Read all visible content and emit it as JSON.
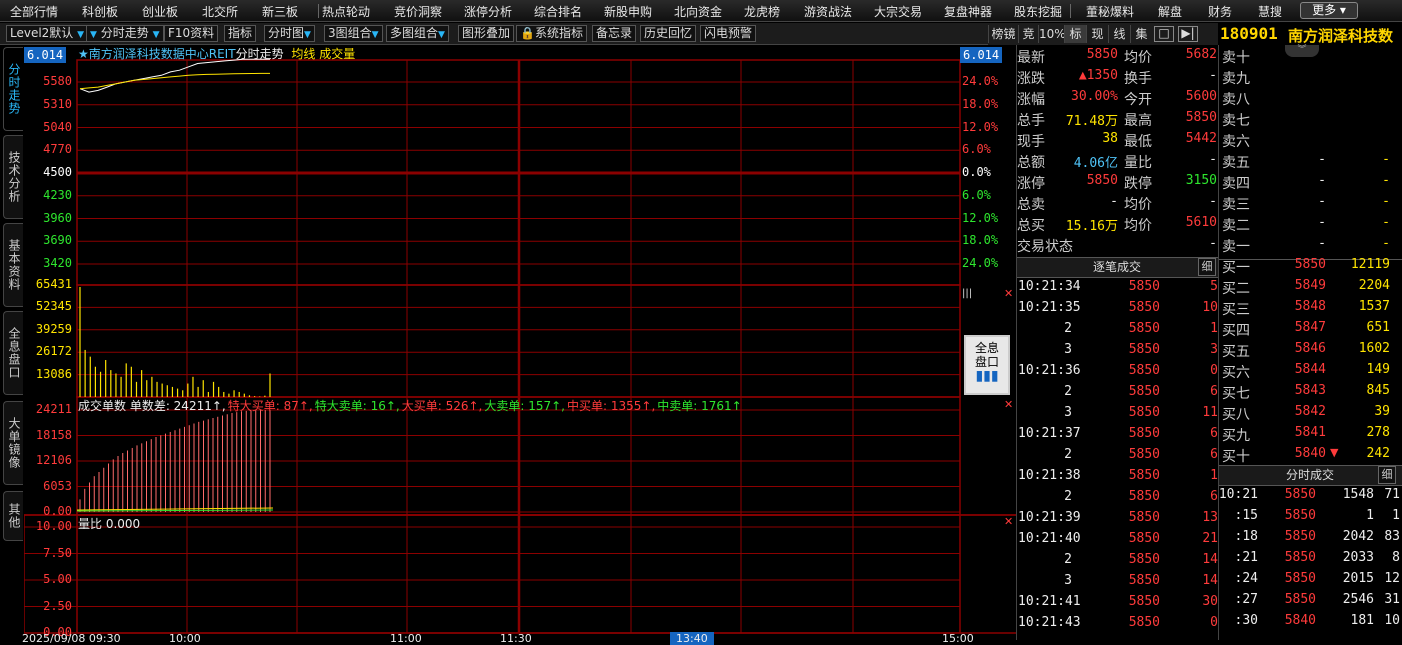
{
  "top_menu": [
    "全部行情",
    "科创板",
    "创业板",
    "北交所",
    "新三板",
    "热点轮动",
    "竞价洞察",
    "涨停分析",
    "综合排名",
    "新股申购",
    "北向资金",
    "龙虎榜",
    "游资战法",
    "大宗交易",
    "复盘神器",
    "股东挖掘",
    "董秘爆料",
    "解盘",
    "财务",
    "慧搜"
  ],
  "more_label": "更多",
  "toolbar": {
    "level2": "Level2默认",
    "timeshare": "分时走势",
    "f10": "F10资料",
    "indicator": "指标",
    "timechart": "分时图",
    "combo3": "3图组合",
    "combo_multi": "多图组合",
    "overlay": "图形叠加",
    "sys_indicator": "系统指标",
    "memo": "备忘录",
    "history": "历史回忆",
    "flash": "闪电预警"
  },
  "right_toolbar": [
    "榜镜",
    "竞",
    "10%",
    "标",
    "现",
    "线",
    "集"
  ],
  "security": {
    "code": "180901",
    "name": "南方润泽科技数"
  },
  "side_tabs": [
    "分时走势",
    "技术分析",
    "基本资料",
    "全息盘口",
    "大单镜像",
    "其他"
  ],
  "chart_header": {
    "badge": "6.014",
    "title": "★南方润泽科技数据中心REIT",
    "mode": "分时走势",
    "avg_label": "均线",
    "vol_label": "成交量"
  },
  "price_axis": {
    "left": [
      "5580",
      "5310",
      "5040",
      "4770",
      "4500",
      "4230",
      "3960",
      "3690",
      "3420"
    ],
    "right": [
      "24.0%",
      "18.0%",
      "12.0%",
      "6.0%",
      "0.0%",
      "6.0%",
      "12.0%",
      "18.0%",
      "24.0%"
    ]
  },
  "volume_axis": [
    "65431",
    "52345",
    "39259",
    "26172",
    "13086"
  ],
  "order_panel": {
    "header": "成交单数 单数差: 24211↑,",
    "items": [
      {
        "label": "特大买单: 87↑,",
        "color": "#ff3b3b"
      },
      {
        "label": "特大卖单: 16↑,",
        "color": "#2ee62e"
      },
      {
        "label": "大买单: 526↑,",
        "color": "#ff3b3b"
      },
      {
        "label": "大卖单: 157↑,",
        "color": "#2ee62e"
      },
      {
        "label": "中买单: 1355↑,",
        "color": "#ff3b3b"
      },
      {
        "label": "中卖单: 1761↑",
        "color": "#2ee62e"
      }
    ],
    "axis": [
      "24211",
      "18158",
      "12106",
      "6053",
      "0.00"
    ]
  },
  "ratio_panel": {
    "label": "量比 0.000",
    "axis": [
      "10.00",
      "7.50",
      "5.00",
      "2.50",
      "0.00"
    ]
  },
  "time_axis": [
    "2025/09/08 09:30",
    "10:00",
    "11:00",
    "11:30",
    "13:40",
    "15:00"
  ],
  "full_pankou_button": "全息盘口",
  "quote": [
    {
      "l1": "最新",
      "v1": "5850",
      "c1": "red",
      "l2": "均价",
      "v2": "5682",
      "c2": "red"
    },
    {
      "l1": "涨跌",
      "v1": "▲1350",
      "c1": "red",
      "l2": "换手",
      "v2": "-",
      "c2": "white"
    },
    {
      "l1": "涨幅",
      "v1": "30.00%",
      "c1": "red",
      "l2": "今开",
      "v2": "5600",
      "c2": "red"
    },
    {
      "l1": "总手",
      "v1": "71.48万",
      "c1": "yellow",
      "l2": "最高",
      "v2": "5850",
      "c2": "red"
    },
    {
      "l1": "现手",
      "v1": "38",
      "c1": "yellow",
      "l2": "最低",
      "v2": "5442",
      "c2": "red"
    },
    {
      "l1": "总额",
      "v1": "4.06亿",
      "c1": "cyan",
      "l2": "量比",
      "v2": "-",
      "c2": "white"
    },
    {
      "l1": "涨停",
      "v1": "5850",
      "c1": "red",
      "l2": "跌停",
      "v2": "3150",
      "c2": "green"
    },
    {
      "l1": "总卖",
      "v1": "-",
      "c1": "white",
      "l2": "均价",
      "v2": "-",
      "c2": "white"
    },
    {
      "l1": "总买",
      "v1": "15.16万",
      "c1": "yellow",
      "l2": "均价",
      "v2": "5610",
      "c2": "red"
    },
    {
      "l1": "交易状态",
      "v1": "",
      "c1": "white",
      "l2": "",
      "v2": "-",
      "c2": "white"
    }
  ],
  "sell_book": [
    {
      "label": "卖十",
      "price": "",
      "vol": ""
    },
    {
      "label": "卖九",
      "price": "",
      "vol": ""
    },
    {
      "label": "卖八",
      "price": "",
      "vol": ""
    },
    {
      "label": "卖七",
      "price": "",
      "vol": ""
    },
    {
      "label": "卖六",
      "price": "",
      "vol": ""
    },
    {
      "label": "卖五",
      "price": "-",
      "vol": "-"
    },
    {
      "label": "卖四",
      "price": "-",
      "vol": "-"
    },
    {
      "label": "卖三",
      "price": "-",
      "vol": "-"
    },
    {
      "label": "卖二",
      "price": "-",
      "vol": "-"
    },
    {
      "label": "卖一",
      "price": "-",
      "vol": "-"
    }
  ],
  "buy_book": [
    {
      "label": "买一",
      "price": "5850",
      "vol": "12119"
    },
    {
      "label": "买二",
      "price": "5849",
      "vol": "2204"
    },
    {
      "label": "买三",
      "price": "5848",
      "vol": "1537"
    },
    {
      "label": "买四",
      "price": "5847",
      "vol": "651"
    },
    {
      "label": "买五",
      "price": "5846",
      "vol": "1602"
    },
    {
      "label": "买六",
      "price": "5844",
      "vol": "149"
    },
    {
      "label": "买七",
      "price": "5843",
      "vol": "845"
    },
    {
      "label": "买八",
      "price": "5842",
      "vol": "39"
    },
    {
      "label": "买九",
      "price": "5841",
      "vol": "278"
    },
    {
      "label": "买十",
      "price": "5840",
      "vol": "242"
    }
  ],
  "tick_header": "逐笔成交",
  "tick_btn": "细",
  "ticks": [
    {
      "t": "10:21:34",
      "p": "5850",
      "v": "5"
    },
    {
      "t": "10:21:35",
      "p": "5850",
      "v": "10"
    },
    {
      "t": "2",
      "p": "5850",
      "v": "1"
    },
    {
      "t": "3",
      "p": "5850",
      "v": "3"
    },
    {
      "t": "10:21:36",
      "p": "5850",
      "v": "0"
    },
    {
      "t": "2",
      "p": "5850",
      "v": "6"
    },
    {
      "t": "3",
      "p": "5850",
      "v": "11"
    },
    {
      "t": "10:21:37",
      "p": "5850",
      "v": "6"
    },
    {
      "t": "2",
      "p": "5850",
      "v": "6"
    },
    {
      "t": "10:21:38",
      "p": "5850",
      "v": "1"
    },
    {
      "t": "2",
      "p": "5850",
      "v": "6"
    },
    {
      "t": "10:21:39",
      "p": "5850",
      "v": "13"
    },
    {
      "t": "10:21:40",
      "p": "5850",
      "v": "21"
    },
    {
      "t": "2",
      "p": "5850",
      "v": "14"
    },
    {
      "t": "3",
      "p": "5850",
      "v": "14"
    },
    {
      "t": "10:21:41",
      "p": "5850",
      "v": "30"
    },
    {
      "t": "10:21:43",
      "p": "5850",
      "v": "0"
    }
  ],
  "min_header": "分时成交",
  "min_btn": "细",
  "min_ticks": [
    {
      "t": "10:21",
      "p": "5850",
      "v": "1548",
      "n": "71"
    },
    {
      "t": ":15",
      "p": "5850",
      "v": "1",
      "n": "1"
    },
    {
      "t": ":18",
      "p": "5850",
      "v": "2042",
      "n": "83"
    },
    {
      "t": ":21",
      "p": "5850",
      "v": "2033",
      "n": "8"
    },
    {
      "t": ":24",
      "p": "5850",
      "v": "2015",
      "n": "12"
    },
    {
      "t": ":27",
      "p": "5850",
      "v": "2546",
      "n": "31"
    },
    {
      "t": ":30",
      "p": "5840",
      "v": "181",
      "n": "10"
    }
  ],
  "colors": {
    "grid": "#8b0000",
    "red": "#ff3b3b",
    "green": "#2ee62e",
    "yellow": "#ffe400",
    "cyan": "#4fc3f7",
    "blue": "#1565c0"
  },
  "chart_data": {
    "type": "line",
    "title": "南方润泽科技数据中心REIT",
    "price_range": [
      3420,
      5580
    ],
    "prev_close": 4500,
    "price_series": [
      5500,
      5460,
      5480,
      5520,
      5560,
      5580,
      5600,
      5620,
      5640,
      5660,
      5700,
      5720,
      5760,
      5800,
      5810,
      5820,
      5830,
      5840,
      5850,
      5850,
      5850,
      5850
    ],
    "avg_series": [
      5500,
      5510,
      5520,
      5540,
      5560,
      5580,
      5600,
      5610,
      5620,
      5630,
      5640,
      5650,
      5660,
      5665,
      5670,
      5672,
      5675,
      5678,
      5680,
      5681,
      5682,
      5682
    ],
    "volume": [
      65431,
      28000,
      24000,
      18000,
      15000,
      22000,
      16000,
      14000,
      12000,
      20000,
      18000,
      9000,
      16000,
      10000,
      12000,
      9000,
      8000,
      7000,
      6000,
      5000,
      4000,
      8000,
      12000,
      6000,
      10000,
      3000,
      9000,
      6000,
      3000,
      2000,
      4000,
      3000,
      2000,
      1000,
      500,
      300,
      800,
      14000
    ],
    "order_diff": [
      3000,
      5500,
      7000,
      8500,
      9500,
      10500,
      11500,
      12500,
      13300,
      14000,
      14600,
      15200,
      15800,
      16300,
      16800,
      17300,
      17800,
      18200,
      18600,
      19000,
      19400,
      19800,
      20200,
      20600,
      21000,
      21400,
      21700,
      22000,
      22300,
      22600,
      22900,
      23200,
      23500,
      23700,
      23900,
      24000,
      24100,
      24150,
      24180,
      24200,
      24211
    ]
  }
}
